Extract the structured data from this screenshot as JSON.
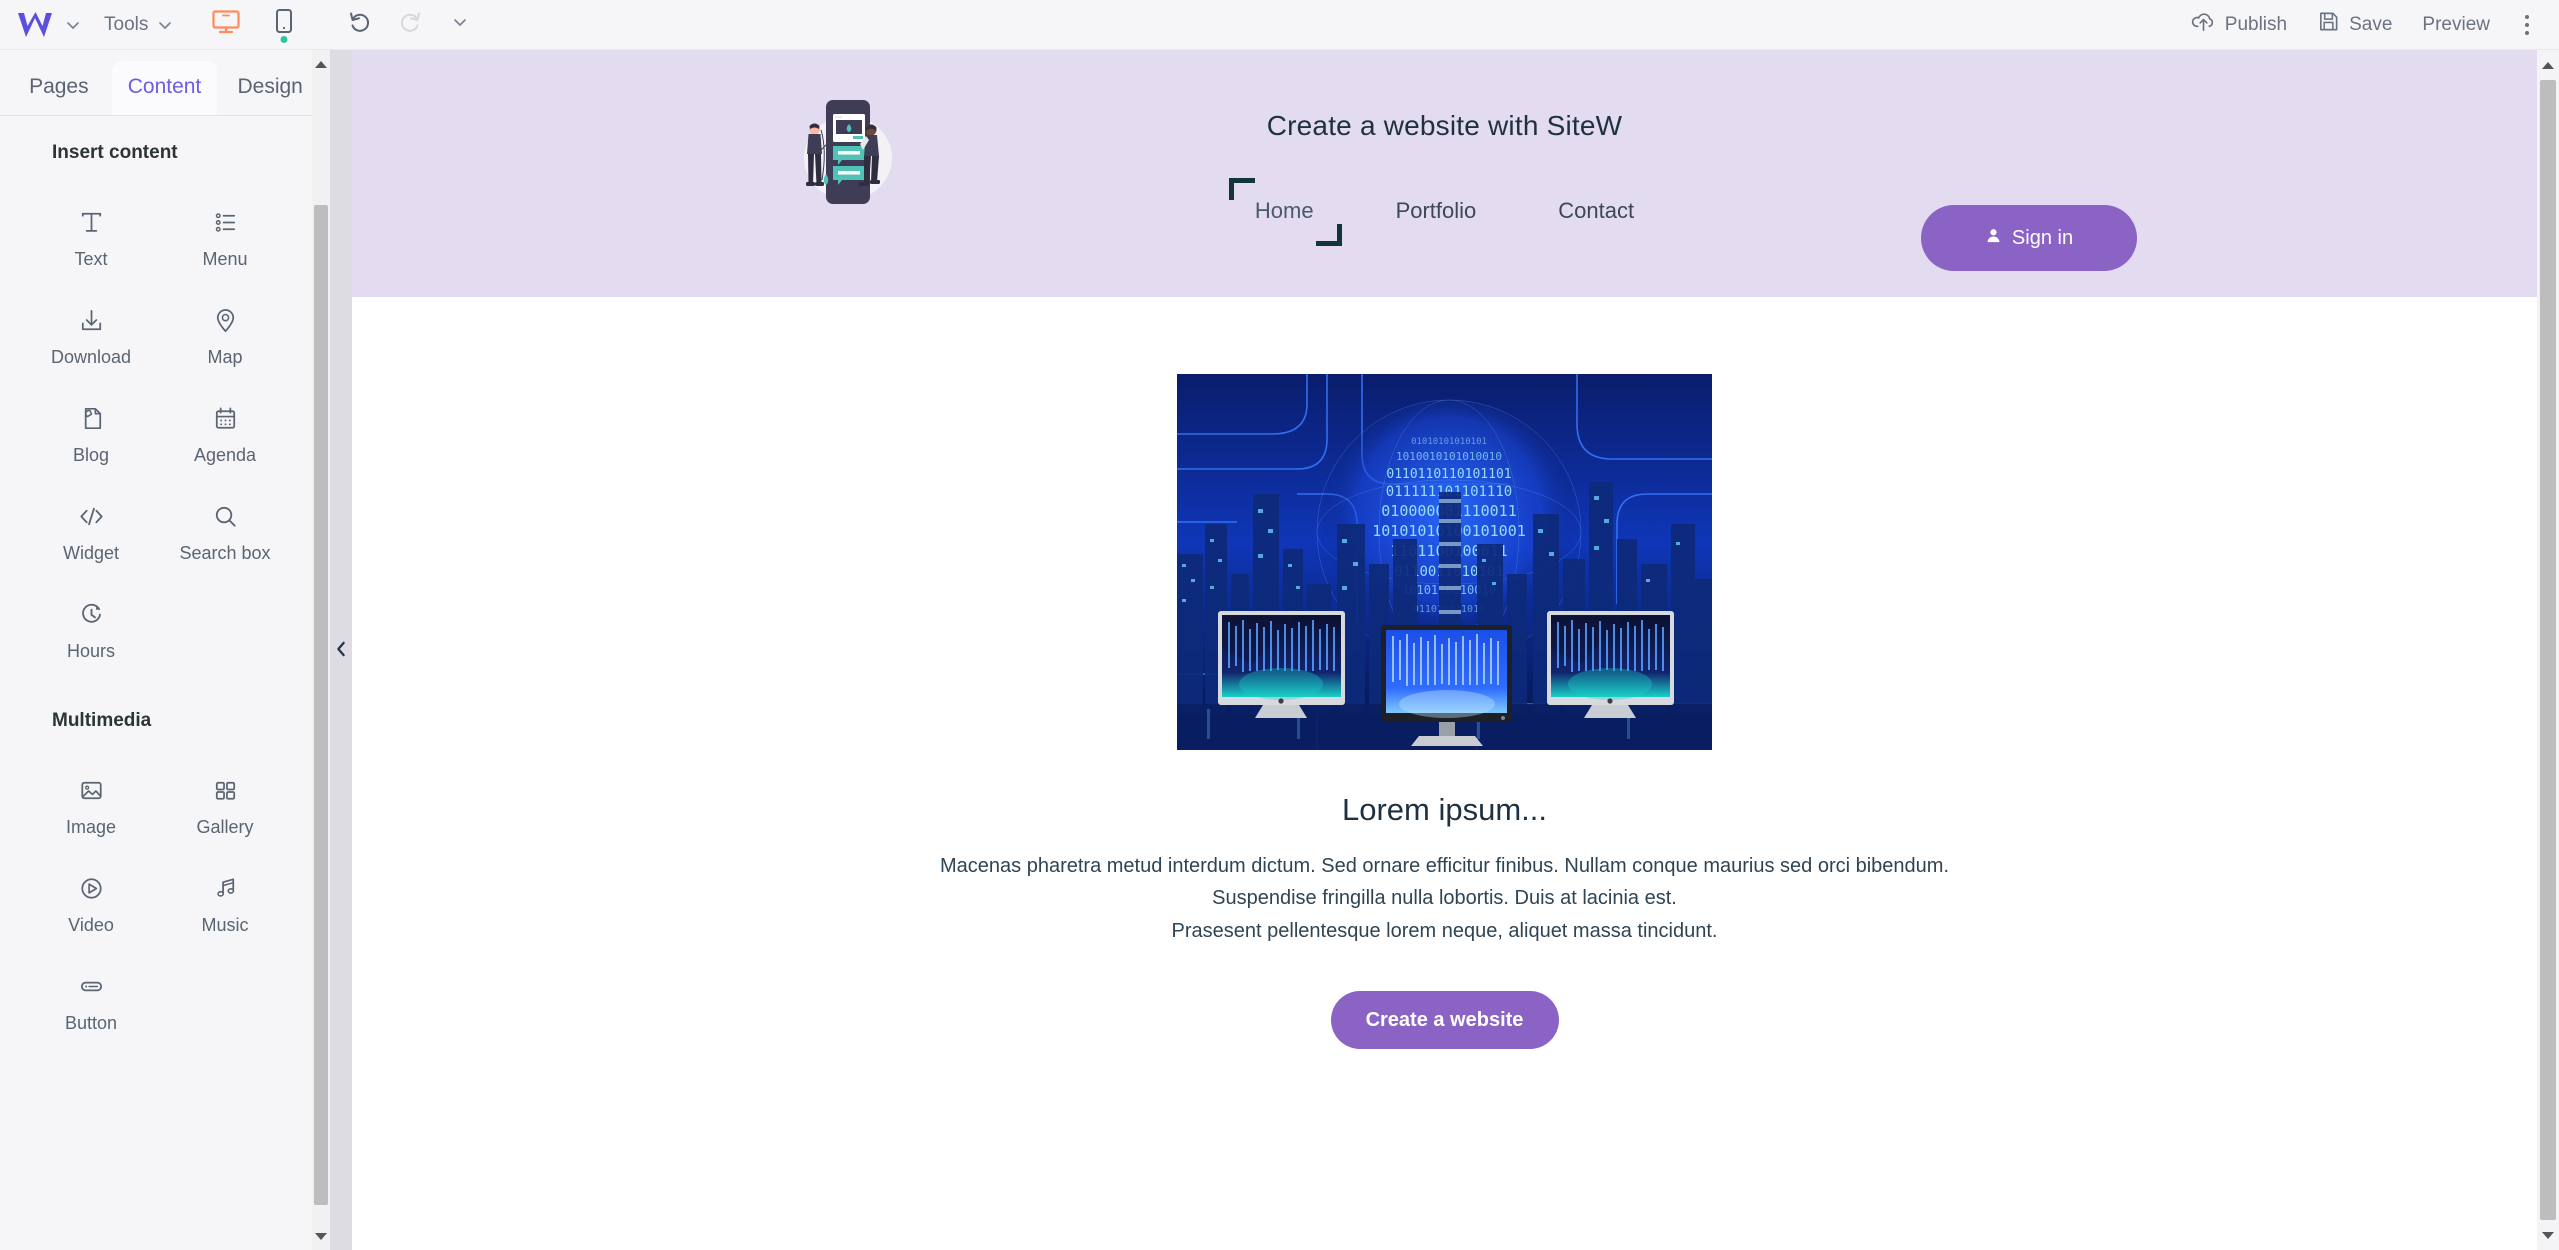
{
  "toolbar": {
    "brand_icon": "sitew-w-logo",
    "brand_chevron_icon": "chevron-down-icon",
    "tools_label": "Tools",
    "tools_chevron_icon": "chevron-down-icon",
    "desktop_icon": "desktop-monitor-icon",
    "mobile_icon": "mobile-phone-icon",
    "mobile_status_dot_color": "#2ec4a0",
    "undo_icon": "undo-arrow-icon",
    "redo_icon": "redo-arrow-icon",
    "history_chevron_icon": "chevron-down-icon",
    "publish_label": "Publish",
    "publish_icon": "cloud-upload-icon",
    "save_label": "Save",
    "save_icon": "floppy-disk-icon",
    "preview_label": "Preview",
    "more_icon": "kebab-menu-icon"
  },
  "left_panel": {
    "tabs": [
      {
        "label": "Pages",
        "active": false
      },
      {
        "label": "Content",
        "active": true
      },
      {
        "label": "Design",
        "active": false
      }
    ],
    "sections": [
      {
        "title": "Insert content",
        "items": [
          {
            "label": "Text",
            "icon": "text-t-icon"
          },
          {
            "label": "Menu",
            "icon": "list-menu-icon"
          },
          {
            "label": "Download",
            "icon": "download-arrow-icon"
          },
          {
            "label": "Map",
            "icon": "map-pin-icon"
          },
          {
            "label": "Blog",
            "icon": "blog-page-icon"
          },
          {
            "label": "Agenda",
            "icon": "calendar-icon"
          },
          {
            "label": "Widget",
            "icon": "code-brackets-icon"
          },
          {
            "label": "Search box",
            "icon": "search-icon"
          },
          {
            "label": "Hours",
            "icon": "clock-icon"
          }
        ]
      },
      {
        "title": "Multimedia",
        "items": [
          {
            "label": "Image",
            "icon": "picture-icon"
          },
          {
            "label": "Gallery",
            "icon": "grid-squares-icon"
          },
          {
            "label": "Video",
            "icon": "play-circle-icon"
          },
          {
            "label": "Music",
            "icon": "music-note-icon"
          },
          {
            "label": "Button",
            "icon": "pill-button-icon"
          }
        ]
      }
    ],
    "collapse_icon": "chevron-left-icon",
    "scroll_up_icon": "triangle-up-icon",
    "scroll_down_icon": "triangle-down-icon"
  },
  "canvas": {
    "header": {
      "background_color": "#e3dbef",
      "logo_icon": "people-and-phone-illustration",
      "site_title": "Create a website with SiteW",
      "nav": [
        {
          "label": "Home",
          "selected": true
        },
        {
          "label": "Portfolio",
          "selected": false
        },
        {
          "label": "Contact",
          "selected": false
        }
      ],
      "signin_label": "Sign in",
      "signin_icon": "person-icon",
      "signin_color": "#8a63c4"
    },
    "body": {
      "hero_image_alt": "blue-city-binary-monitors-image",
      "heading": "Lorem ipsum...",
      "paragraph_lines": [
        "Macenas pharetra metud interdum dictum. Sed ornare efficitur finibus. Nullam conque maurius sed orci bibendum.",
        "Suspendise fringilla nulla lobortis. Duis at lacinia est.",
        "Prasesent pellentesque lorem neque, aliquet massa tincidunt."
      ],
      "cta_label": "Create a website",
      "cta_color": "#8a63c4"
    },
    "scroll_up_icon": "triangle-up-icon",
    "scroll_down_icon": "triangle-down-icon"
  }
}
